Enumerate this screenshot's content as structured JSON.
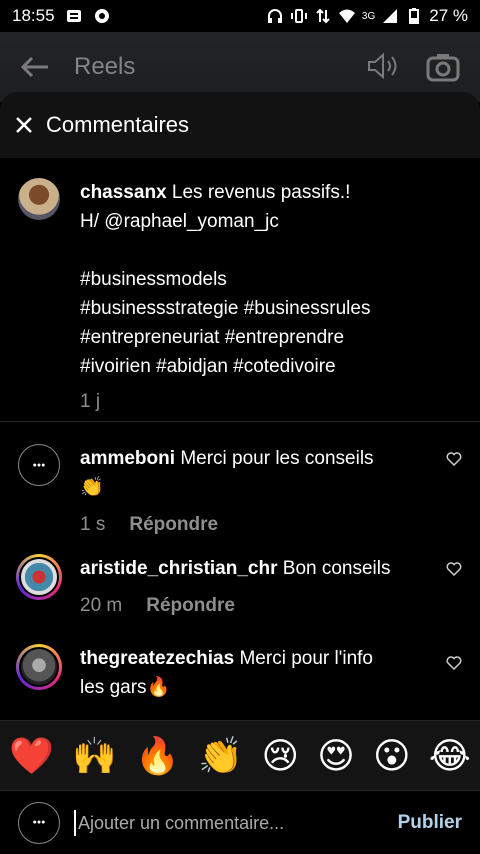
{
  "status": {
    "time": "18:55",
    "battery_text": "27 %",
    "signal_text": "3G"
  },
  "reels_header": {
    "title": "Reels"
  },
  "sheet": {
    "title": "Commentaires"
  },
  "caption": {
    "username": "chassanx",
    "text_line1": "Les revenus passifs.!",
    "text_line2": "H/ @raphael_yoman_jc",
    "hashtags_line1": "#businessmodels",
    "hashtags_line2": "#businessstrategie #businessrules",
    "hashtags_line3": "#entrepreneuriat #entreprendre",
    "hashtags_line4": "#ivoirien #abidjan #cotedivoire",
    "time": "1 j"
  },
  "comments": [
    {
      "username": "ammeboni",
      "text": "Merci pour les conseils",
      "emoji": "👏",
      "time": "1 s",
      "reply_label": "Répondre"
    },
    {
      "username": "aristide_christian_chr",
      "text": "Bon conseils",
      "time": "20 m",
      "reply_label": "Répondre"
    },
    {
      "username": "thegreatezechias",
      "text": "Merci pour l'info",
      "text2": "les gars",
      "emoji": "🔥"
    }
  ],
  "reactions": [
    "❤️",
    "🙌",
    "🔥",
    "👏",
    "😢",
    "😍",
    "😮",
    "😂"
  ],
  "composer": {
    "placeholder": "Ajouter un commentaire...",
    "publish_label": "Publier"
  },
  "colors": {
    "publish": "#b3d2ea",
    "muted": "#8e8e8e"
  }
}
